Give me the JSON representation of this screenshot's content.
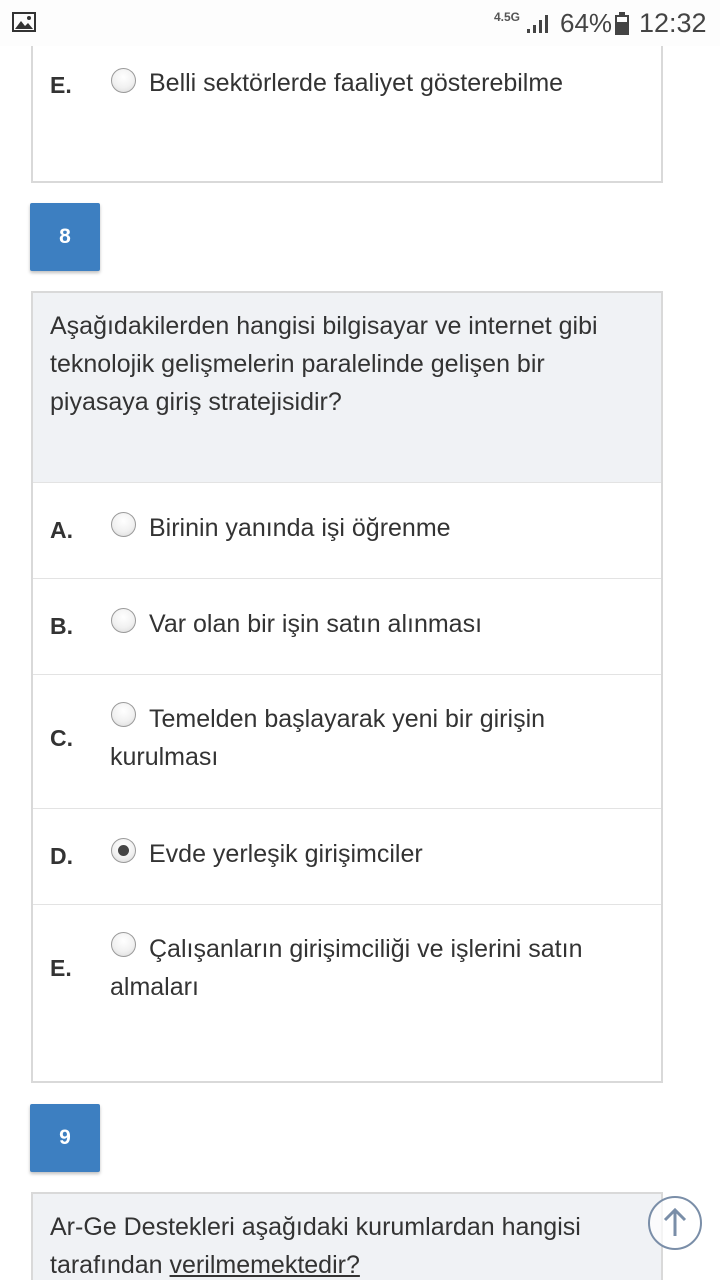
{
  "status_bar": {
    "image_icon": "picture-icon",
    "network": "4.5G",
    "battery_percent": "64%",
    "time": "12:32"
  },
  "prev_question": {
    "option_e": {
      "letter": "E.",
      "text": "Belli sektörlerde faaliyet gösterebilme"
    }
  },
  "question8": {
    "number": "8",
    "text": "Aşağıdakilerden hangisi bilgisayar ve internet gibi teknolojik gelişmelerin paralelinde gelişen bir piyasaya giriş stratejisidir?",
    "options": [
      {
        "letter": "A.",
        "text": "Birinin yanında işi öğrenme",
        "selected": false
      },
      {
        "letter": "B.",
        "text": "Var olan bir işin satın alınması",
        "selected": false
      },
      {
        "letter": "C.",
        "text_line1": "Temelden başlayarak yeni bir girişin",
        "text_line2": "kurulması",
        "selected": false
      },
      {
        "letter": "D.",
        "text": "Evde yerleşik girişimciler",
        "selected": true
      },
      {
        "letter": "E.",
        "text_line1": "Çalışanların girişimciliği ve işlerini satın",
        "text_line2": "almaları",
        "selected": false
      }
    ]
  },
  "question9": {
    "number": "9",
    "text_line1": "Ar-Ge Destekleri aşağıdaki kurumlardan hangisi",
    "text_prefix": "tarafından ",
    "text_underlined": "verilmemektedir?"
  },
  "scroll_top_icon": "arrow-up-circle-icon"
}
